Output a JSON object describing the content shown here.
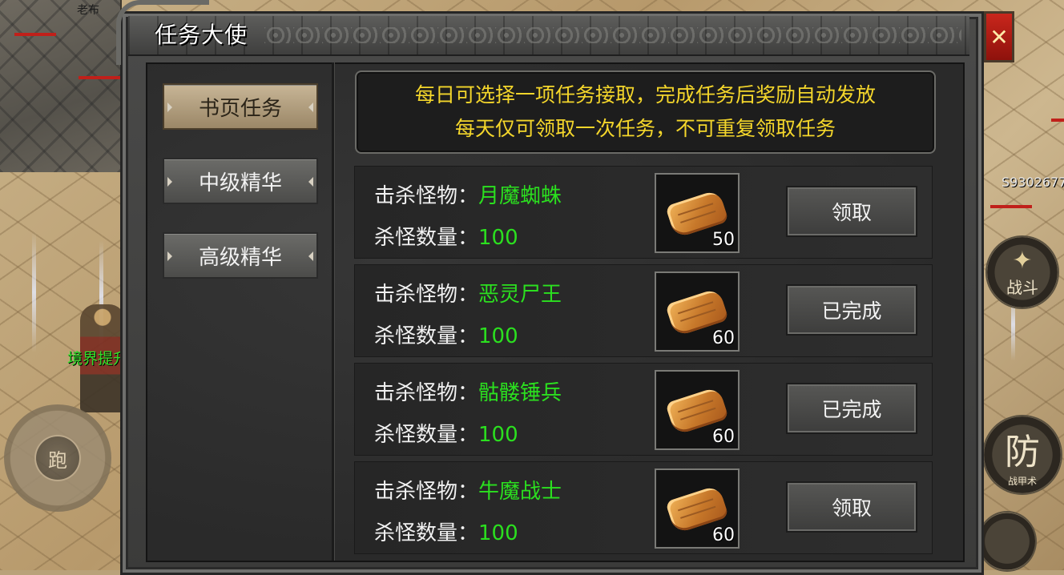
{
  "background": {
    "map_label": "老布",
    "hero_name": "境界提升",
    "run_label": "跑",
    "player_id": "S9302677",
    "skills": [
      {
        "glyph": "✦",
        "caption": "战斗"
      },
      {
        "glyph": "防",
        "caption": "战甲术"
      }
    ]
  },
  "dialog": {
    "title": "任务大使",
    "close_label": "✕",
    "tabs": [
      {
        "label": "书页任务",
        "active": true
      },
      {
        "label": "中级精华",
        "active": false
      },
      {
        "label": "高级精华",
        "active": false
      }
    ],
    "notice": {
      "line1": "每日可选择一项任务接取，完成任务后奖励自动发放",
      "line2": "每天仅可领取一次任务，不可重复领取任务"
    },
    "kill_label": "击杀怪物：",
    "count_label": "杀怪数量：",
    "tasks": [
      {
        "monster": "月魔蜘蛛",
        "count": "100",
        "reward_qty": "50",
        "action": "领取"
      },
      {
        "monster": "恶灵尸王",
        "count": "100",
        "reward_qty": "60",
        "action": "已完成"
      },
      {
        "monster": "骷髅锤兵",
        "count": "100",
        "reward_qty": "60",
        "action": "已完成"
      },
      {
        "monster": "牛魔战士",
        "count": "100",
        "reward_qty": "60",
        "action": "领取"
      }
    ]
  },
  "colors": {
    "notice_text": "#f4d62b",
    "value_green": "#2be01f",
    "close_red": "#c9261c"
  }
}
